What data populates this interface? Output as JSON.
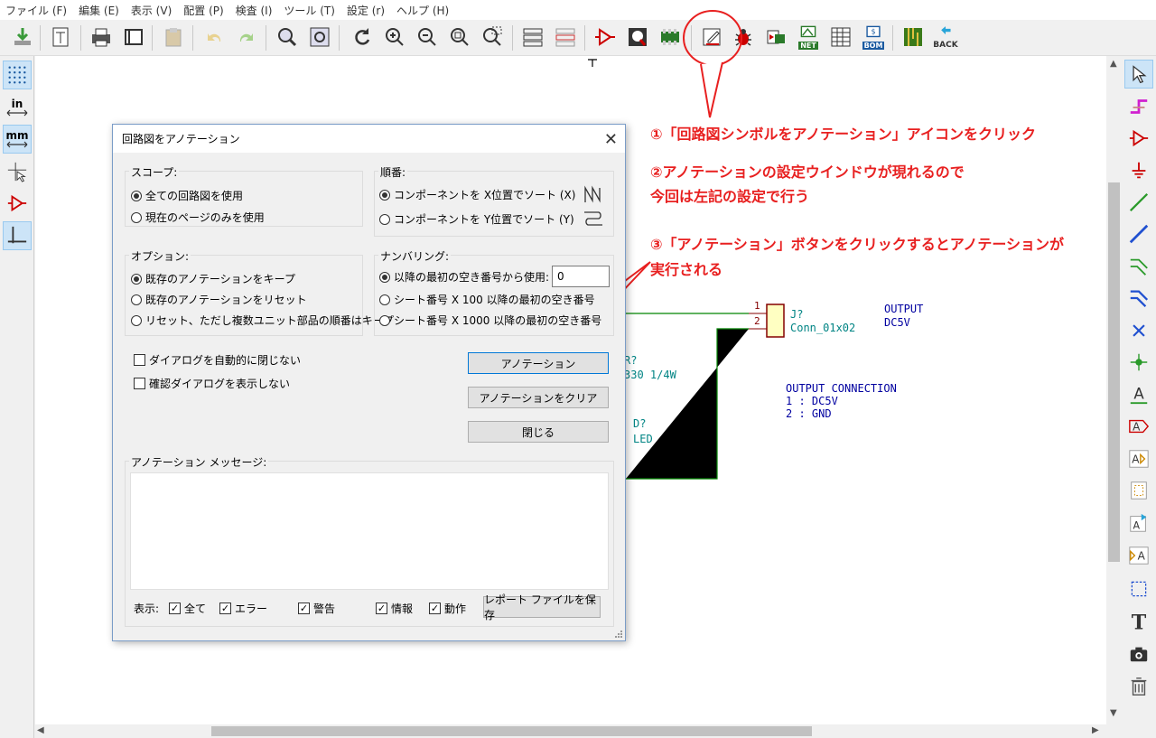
{
  "menu": [
    "ファイル (F)",
    "編集 (E)",
    "表示 (V)",
    "配置 (P)",
    "検査 (I)",
    "ツール (T)",
    "設定 (r)",
    "ヘルプ (H)"
  ],
  "toolbar": {
    "bom_label": "BOM",
    "net_label": "NET",
    "back_label": "BACK"
  },
  "left_toolbar": {
    "in_label": "in",
    "mm_label": "mm"
  },
  "schematic": {
    "pin1": "1",
    "pin2": "2",
    "conn_ref": "J?",
    "conn_value": "Conn_01x02",
    "output_label": "OUTPUT",
    "output_value": "DC5V",
    "res_ref": "R?",
    "res_value": "330 1/4W",
    "led_ref": "D?",
    "led_value": "LED",
    "note_title": "OUTPUT CONNECTION",
    "note_line1": "1 : DC5V",
    "note_line2": "2 : GND"
  },
  "annotations": {
    "step1": "①「回路図シンボルをアノテーション」アイコンをクリック",
    "step2_line1": "②アノテーションの設定ウインドウが現れるので",
    "step2_line2": "今回は左記の設定で行う",
    "step3_line1": "③「アノテーション」ボタンをクリックするとアノテーションが",
    "step3_line2": "実行される"
  },
  "dialog": {
    "title": "回路図をアノテーション",
    "scope": {
      "title": "スコープ:",
      "options": [
        "全ての回路図を使用",
        "現在のページのみを使用"
      ],
      "selected": 0
    },
    "order": {
      "title": "順番:",
      "options": [
        "コンポーネントを X位置でソート (X)",
        "コンポーネントを Y位置でソート (Y)"
      ],
      "selected": 0
    },
    "options": {
      "title": "オプション:",
      "options": [
        "既存のアノテーションをキープ",
        "既存のアノテーションをリセット",
        "リセット、ただし複数ユニット部品の順番はキープ"
      ],
      "selected": 0
    },
    "numbering": {
      "title": "ナンバリング:",
      "options": [
        "以降の最初の空き番号から使用:",
        "シート番号 X 100 以降の最初の空き番号",
        "シート番号 X 1000 以降の最初の空き番号"
      ],
      "selected": 0,
      "start_value": "0"
    },
    "auto_close_label": "ダイアログを自動的に閉じない",
    "no_confirm_label": "確認ダイアログを表示しない",
    "annotate_button": "アノテーション",
    "clear_button": "アノテーションをクリア",
    "close_button": "閉じる",
    "messages_title": "アノテーション メッセージ:",
    "show_label": "表示:",
    "filters": [
      {
        "label": "全て",
        "checked": true
      },
      {
        "label": "エラー",
        "checked": true
      },
      {
        "label": "警告",
        "checked": true
      },
      {
        "label": "情報",
        "checked": true
      },
      {
        "label": "動作",
        "checked": true
      }
    ],
    "save_report_button": "レポート ファイルを保存"
  },
  "colors": {
    "annotation_red": "#e82020",
    "wire_green": "#008400",
    "schematic_teal": "#008484",
    "schematic_blue": "#0000a0"
  }
}
